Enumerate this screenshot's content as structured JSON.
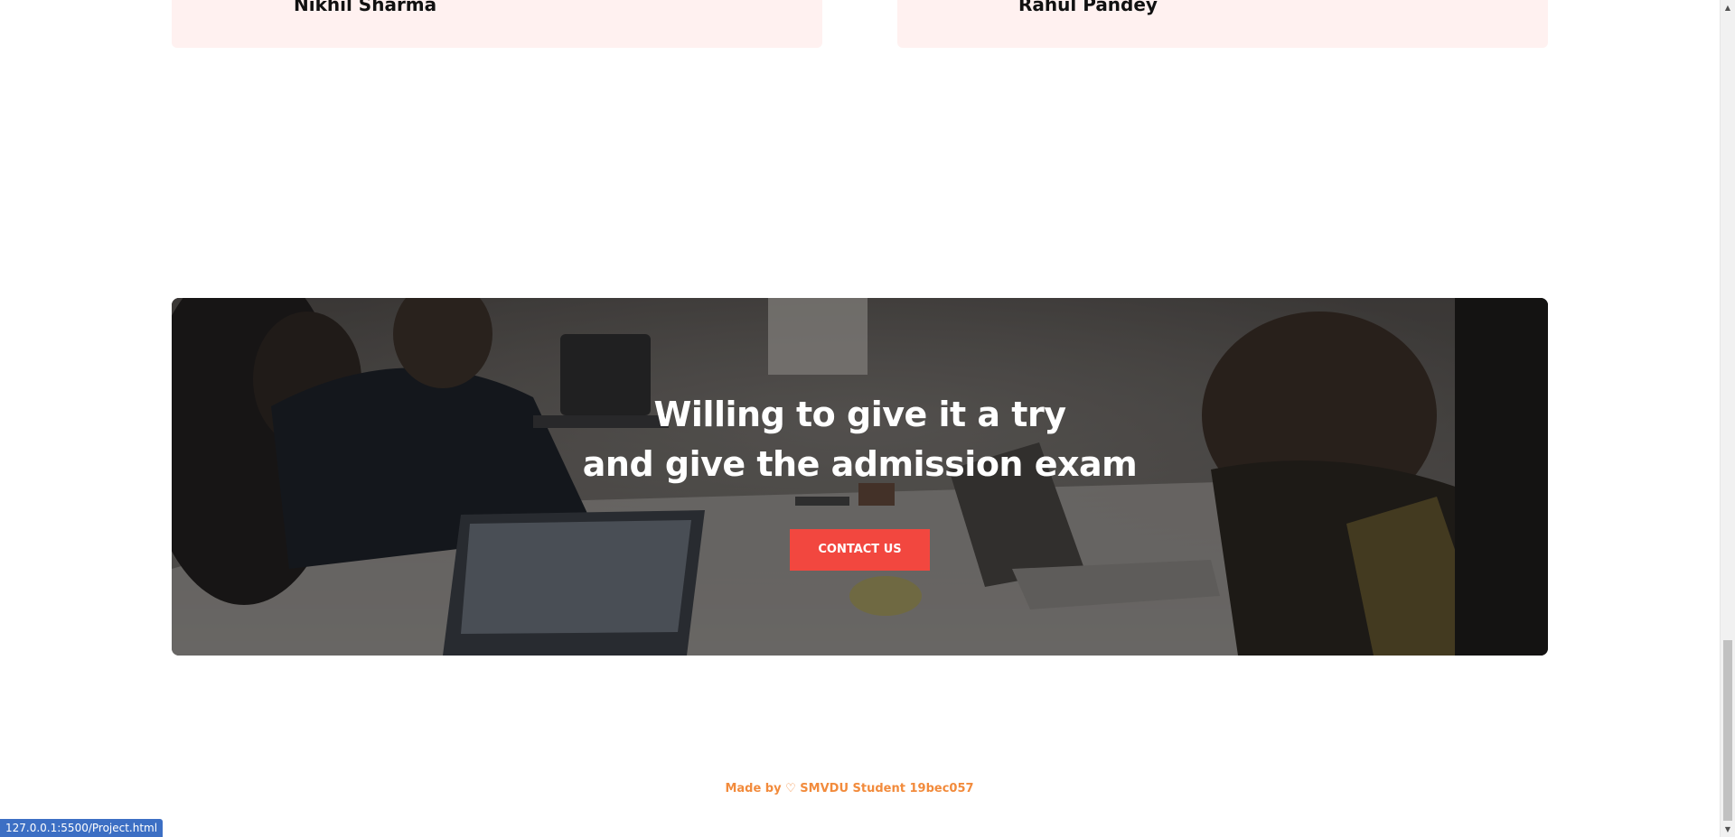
{
  "testimonials": [
    {
      "name": "Nikhil Sharma"
    },
    {
      "name": "Rahul Pandey"
    }
  ],
  "cta": {
    "title_line1": "Willing to give it a try",
    "title_line2": "and give the admission exam",
    "button_label": "CONTACT US"
  },
  "footer": {
    "text": "Made by ♡ SMVDU Student 19bec057"
  },
  "status_bar": {
    "url": "127.0.0.1:5500/Project.html"
  },
  "colors": {
    "accent": "#f2473f",
    "footer_text": "#f28b3c",
    "card_bg": "#fff1f0"
  }
}
